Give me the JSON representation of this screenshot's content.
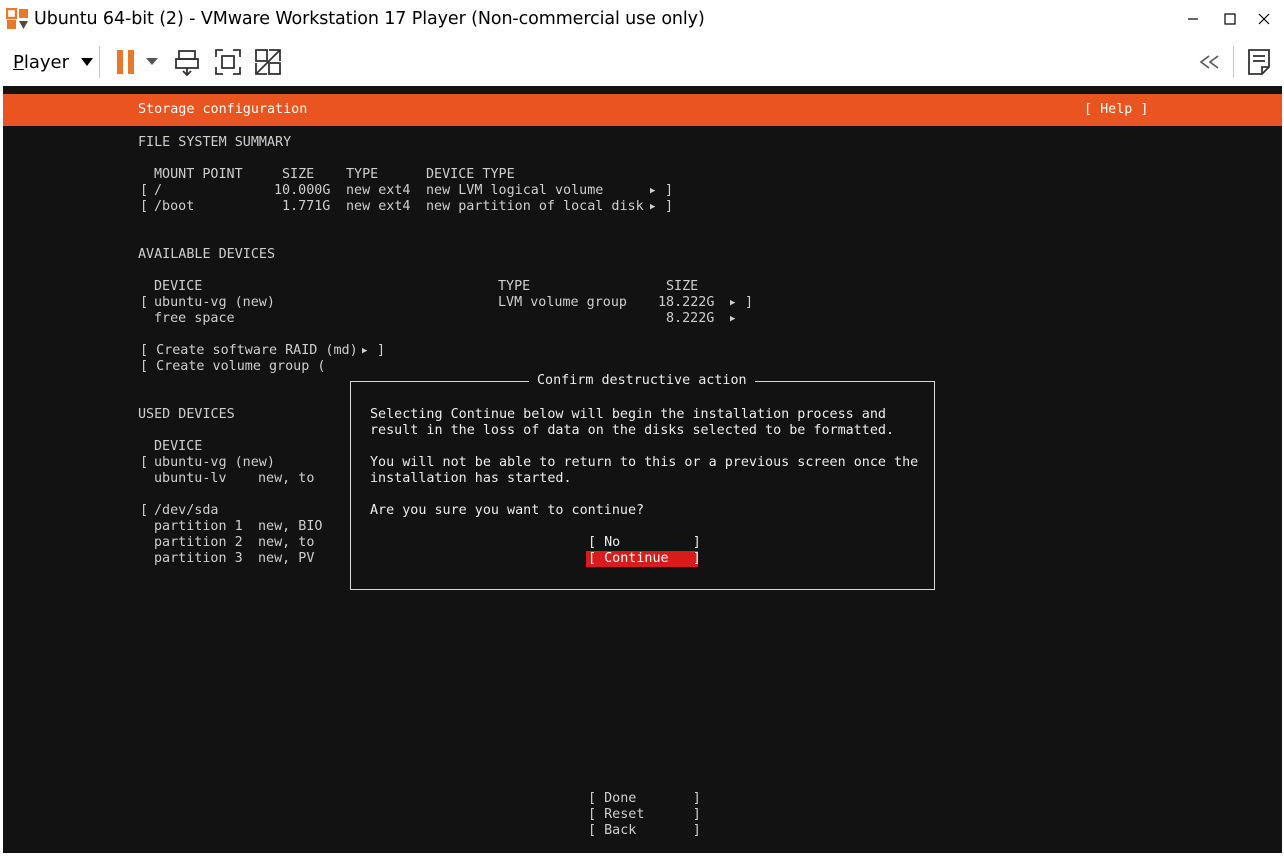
{
  "window": {
    "title": "Ubuntu 64-bit (2) - VMware Workstation 17 Player (Non-commercial use only)",
    "controls": {
      "minimize_icon": "minimize-icon",
      "maximize_icon": "maximize-icon",
      "close_icon": "close-icon"
    }
  },
  "toolbar": {
    "player_initial": "P",
    "player_rest": "layer",
    "icons": [
      "pause-icon",
      "dropdown-caret-icon",
      "send-ctrl-alt-del-icon",
      "fullscreen-icon",
      "unity-icon",
      "collapse-icon",
      "notes-icon"
    ],
    "accent_color": "#e8792b"
  },
  "installer": {
    "header_title": "Storage configuration",
    "help_label": "[ Help ]",
    "header_color": "#e95420",
    "fs_summary": {
      "heading": "FILE SYSTEM SUMMARY",
      "columns": {
        "mount_point": "MOUNT POINT",
        "size": "SIZE",
        "type": "TYPE",
        "device_type": "DEVICE TYPE"
      },
      "rows": [
        {
          "bracket": "[",
          "mount": "/",
          "size": "10.000G",
          "type": "new ext4",
          "device_type": "new LVM logical volume",
          "end": "]"
        },
        {
          "bracket": "[",
          "mount": "/boot",
          "size": "1.771G",
          "type": "new ext4",
          "device_type": "new partition of local disk",
          "end": "]"
        }
      ]
    },
    "available_devices": {
      "heading": "AVAILABLE DEVICES",
      "columns": {
        "device": "DEVICE",
        "type": "TYPE",
        "size": "SIZE"
      },
      "rows": [
        {
          "bracket": "[",
          "device": "ubuntu-vg (new)",
          "type": "LVM volume group",
          "size": "18.222G",
          "end": "]"
        },
        {
          "bracket": "",
          "device": "free space",
          "type": "",
          "size": "8.222G",
          "end": ""
        }
      ],
      "actions": [
        "[ Create software RAID (md) ",
        "[ Create volume group ("
      ],
      "action_end": "]"
    },
    "used_devices": {
      "heading": "USED DEVICES",
      "column_device": "DEVICE",
      "lines": [
        {
          "bracket": "[",
          "name": "ubuntu-vg (new)",
          "info": ""
        },
        {
          "bracket": "",
          "name": "ubuntu-lv",
          "info": "new, to"
        },
        {
          "bracket": "[",
          "name": "/dev/sda",
          "info": ""
        },
        {
          "bracket": "",
          "name": "partition 1",
          "info": "new, BIO"
        },
        {
          "bracket": "",
          "name": "partition 2",
          "info": "new, to"
        },
        {
          "bracket": "",
          "name": "partition 3",
          "info": "new, PV"
        }
      ]
    },
    "bottom_buttons": [
      "[ Done       ]",
      "[ Reset      ]",
      "[ Back       ]"
    ],
    "dialog": {
      "title": "Confirm destructive action",
      "line1": "Selecting Continue below will begin the installation process and",
      "line2": "result in the loss of data on the disks selected to be formatted.",
      "line3": "You will not be able to return to this or a previous screen once the",
      "line4": "installation has started.",
      "question": "Are you sure you want to continue?",
      "no_button": "[ No         ]",
      "continue_button": "[ Continue   ]",
      "continue_color": "#d81c1c"
    }
  }
}
